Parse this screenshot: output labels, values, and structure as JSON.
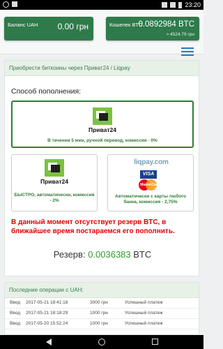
{
  "statusbar": {
    "time": "23:20"
  },
  "balances": {
    "uah": {
      "label": "Баланс UAH",
      "value": "0.00 грн"
    },
    "btc": {
      "label": "Кошелек BTC",
      "value": "0.0892984 BTC",
      "sub": "≈ 4524.79 грн"
    }
  },
  "card": {
    "header": "Приобрести биткоины через Приват24 / Liqpay",
    "section_title": "Способ пополнения:",
    "methods": [
      {
        "logo": "Приват24",
        "caption": "В течении 5 мин, ручной перевод, комиссия - 0%"
      },
      {
        "logo": "Приват24",
        "caption": "БЫСТРО, автоматически, комиссия - 2%"
      },
      {
        "logo": "liqpay.com",
        "caption": "Автоматически с карты любого банка, комиссия - 2,75%"
      }
    ],
    "visa": "VISA",
    "mastercard": "MasterCard",
    "warning": "В данный момент отсутствует резерв BTC, в ближайшее время постараемся его пополнить.",
    "reserve_label": "Резерв:",
    "reserve_value": "0.0036383",
    "reserve_unit": "BTC"
  },
  "operations": {
    "header": "Последние операции с UAH:",
    "rows": [
      [
        "Ввод",
        "2017-05-21 18:41:18",
        "3000 грн",
        "Успешный платеж"
      ],
      [
        "Ввод",
        "2017-05-21 18:18:29",
        "1000 грн",
        "Успешный платеж"
      ],
      [
        "Ввод",
        "2017-05-20 15:52:24",
        "1000 грн",
        "Успешный платеж"
      ]
    ]
  }
}
